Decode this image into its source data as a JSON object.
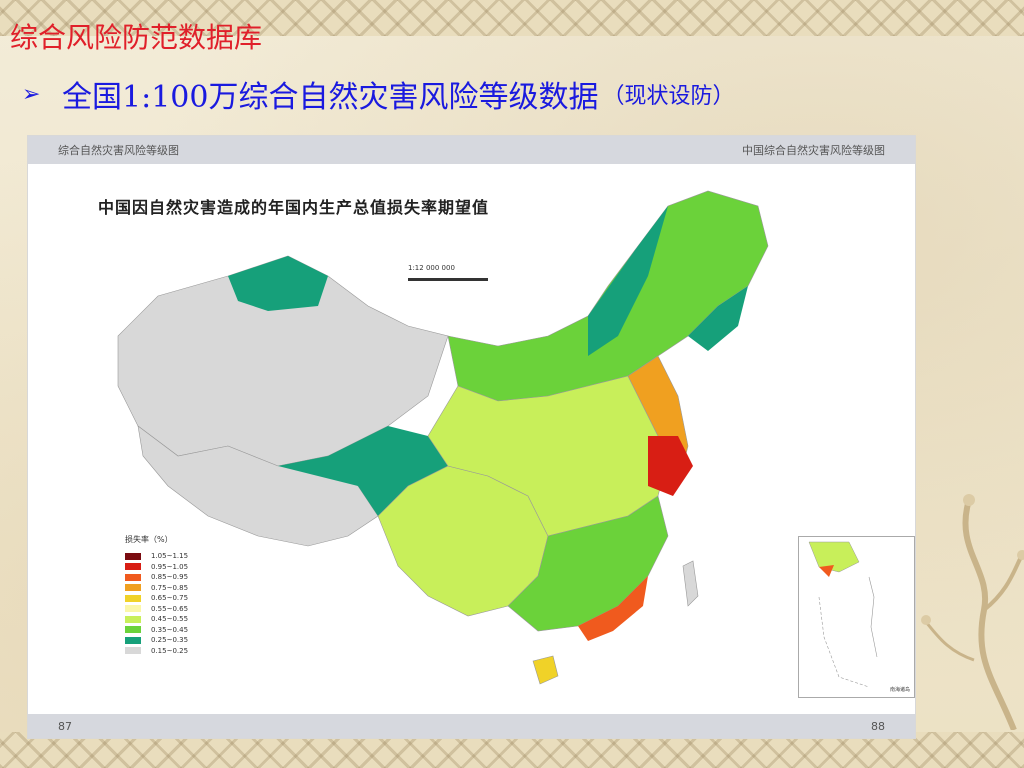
{
  "slide": {
    "title": "综合风险防范数据库",
    "bullet": "➢",
    "subtitle_main": "全国1:100万综合自然灾害风险等级数据",
    "subtitle_note": "（现状设防）"
  },
  "map": {
    "header_left": "综合自然灾害风险等级图",
    "header_right": "中国综合自然灾害风险等级图",
    "title": "中国因自然灾害造成的年国内生产总值损失率期望值",
    "scale": "1:12 000 000",
    "page_left": "87",
    "page_right": "88",
    "legend_title": "损失率（%）",
    "legend": [
      {
        "label": "1.05~1.15",
        "color": "#7a0b10"
      },
      {
        "label": "0.95~1.05",
        "color": "#d81e14"
      },
      {
        "label": "0.85~0.95",
        "color": "#f05a1e"
      },
      {
        "label": "0.75~0.85",
        "color": "#f0a020"
      },
      {
        "label": "0.65~0.75",
        "color": "#f0d228"
      },
      {
        "label": "0.55~0.65",
        "color": "#fbf7a8"
      },
      {
        "label": "0.45~0.55",
        "color": "#c8ef5a"
      },
      {
        "label": "0.35~0.45",
        "color": "#6bd23a"
      },
      {
        "label": "0.25~0.35",
        "color": "#16a07a"
      },
      {
        "label": "0.15~0.25",
        "color": "#d8d8d8"
      }
    ],
    "inset_caption": "南海诸岛"
  }
}
